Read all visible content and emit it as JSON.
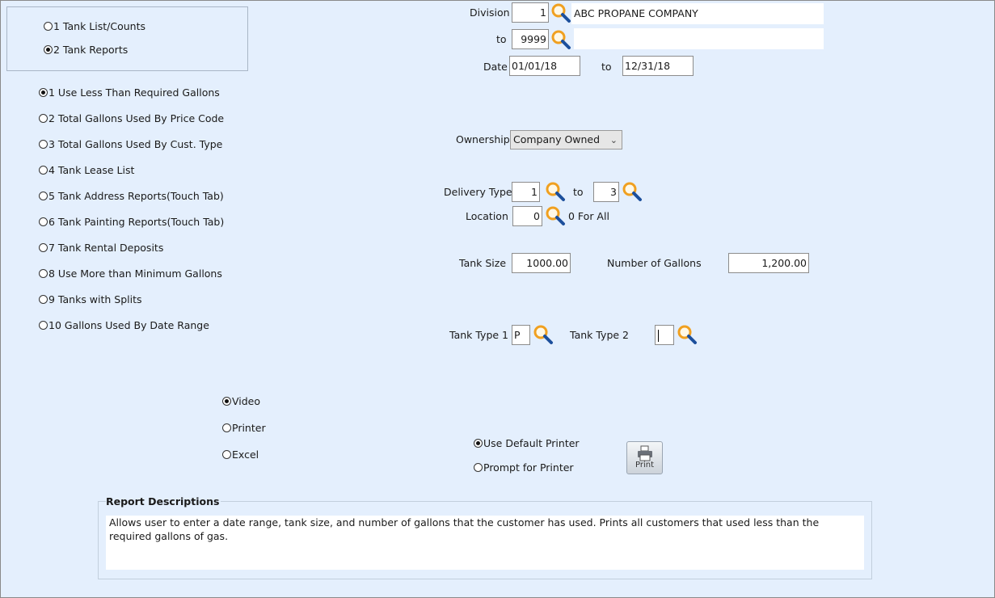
{
  "report_group": {
    "options": [
      {
        "label": "1 Tank List/Counts",
        "selected": false
      },
      {
        "label": "2 Tank Reports",
        "selected": true
      }
    ]
  },
  "reports": {
    "options": [
      {
        "label": "1 Use Less Than Required Gallons",
        "selected": true
      },
      {
        "label": "2 Total Gallons Used By Price Code",
        "selected": false
      },
      {
        "label": "3 Total Gallons Used By Cust. Type",
        "selected": false
      },
      {
        "label": "4 Tank Lease List",
        "selected": false
      },
      {
        "label": "5 Tank Address Reports(Touch Tab)",
        "selected": false
      },
      {
        "label": "6 Tank Painting Reports(Touch Tab)",
        "selected": false
      },
      {
        "label": "7 Tank Rental Deposits",
        "selected": false
      },
      {
        "label": "8 Use More than Minimum Gallons",
        "selected": false
      },
      {
        "label": "9 Tanks with Splits",
        "selected": false
      },
      {
        "label": "10 Gallons Used By Date Range",
        "selected": false
      }
    ]
  },
  "filters": {
    "division_label": "Division",
    "division_from": "1",
    "division_name": "ABC PROPANE COMPANY",
    "to_label": "to",
    "division_to": "9999",
    "division_to_name": "",
    "date_label": "Date",
    "date_from": "01/01/18",
    "date_to_label": "to",
    "date_to": "12/31/18",
    "ownership_label": "Ownership",
    "ownership_value": "Company Owned",
    "delivery_type_label": "Delivery Type",
    "delivery_from": "1",
    "delivery_to_label": "to",
    "delivery_to": "3",
    "location_label": "Location",
    "location_value": "0",
    "location_hint": "0 For All",
    "tank_size_label": "Tank Size",
    "tank_size": "1000.00",
    "gallons_label": "Number of Gallons",
    "gallons": "1,200.00",
    "tank_type1_label": "Tank Type 1",
    "tank_type1": "P",
    "tank_type2_label": "Tank Type 2",
    "tank_type2": ""
  },
  "output": {
    "options": [
      {
        "label": "Video",
        "selected": true
      },
      {
        "label": "Printer",
        "selected": false
      },
      {
        "label": "Excel",
        "selected": false
      }
    ]
  },
  "printer": {
    "options": [
      {
        "label": "Use Default Printer",
        "selected": true
      },
      {
        "label": "Prompt for Printer",
        "selected": false
      }
    ],
    "print_label": "Print"
  },
  "description": {
    "title": "Report Descriptions",
    "text": "Allows user to enter a date range, tank size, and number of gallons that the customer has used. Prints all customers that used less than the required gallons of gas."
  },
  "icons": {
    "lookup": "magnifier-icon",
    "print": "printer-icon"
  },
  "colors": {
    "background": "#e4effd",
    "magnifier_ring": "#f0a020",
    "magnifier_handle": "#1c4f9c"
  }
}
